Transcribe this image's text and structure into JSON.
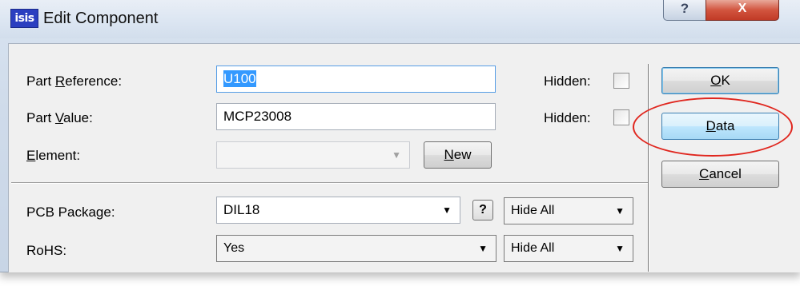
{
  "window": {
    "title": "Edit Component",
    "app_icon_text": "isis",
    "help_label": "?",
    "close_label": "X"
  },
  "fields": {
    "part_reference": {
      "label_pre": "Part ",
      "label_u": "R",
      "label_post": "eference:",
      "value": "U100",
      "hidden_label": "Hidden:",
      "hidden_checked": false
    },
    "part_value": {
      "label_pre": "Part ",
      "label_u": "V",
      "label_post": "alue:",
      "value": "MCP23008",
      "hidden_label": "Hidden:",
      "hidden_checked": false
    },
    "element": {
      "label_u": "E",
      "label_post": "lement:",
      "value": "",
      "new_pre": "",
      "new_u": "N",
      "new_post": "ew"
    },
    "pcb_package": {
      "label": "PCB Package:",
      "value": "DIL18",
      "help": "?",
      "visibility": "Hide All"
    },
    "rohs": {
      "label": "RoHS:",
      "value": "Yes",
      "visibility": "Hide All"
    }
  },
  "buttons": {
    "ok": {
      "u": "O",
      "post": "K"
    },
    "data": {
      "u": "D",
      "post": "ata"
    },
    "cancel": {
      "u": "C",
      "post": "ancel"
    }
  },
  "colors": {
    "selection": "#3399ff",
    "annotation": "#e0261e",
    "close_button": "#c13a26"
  }
}
